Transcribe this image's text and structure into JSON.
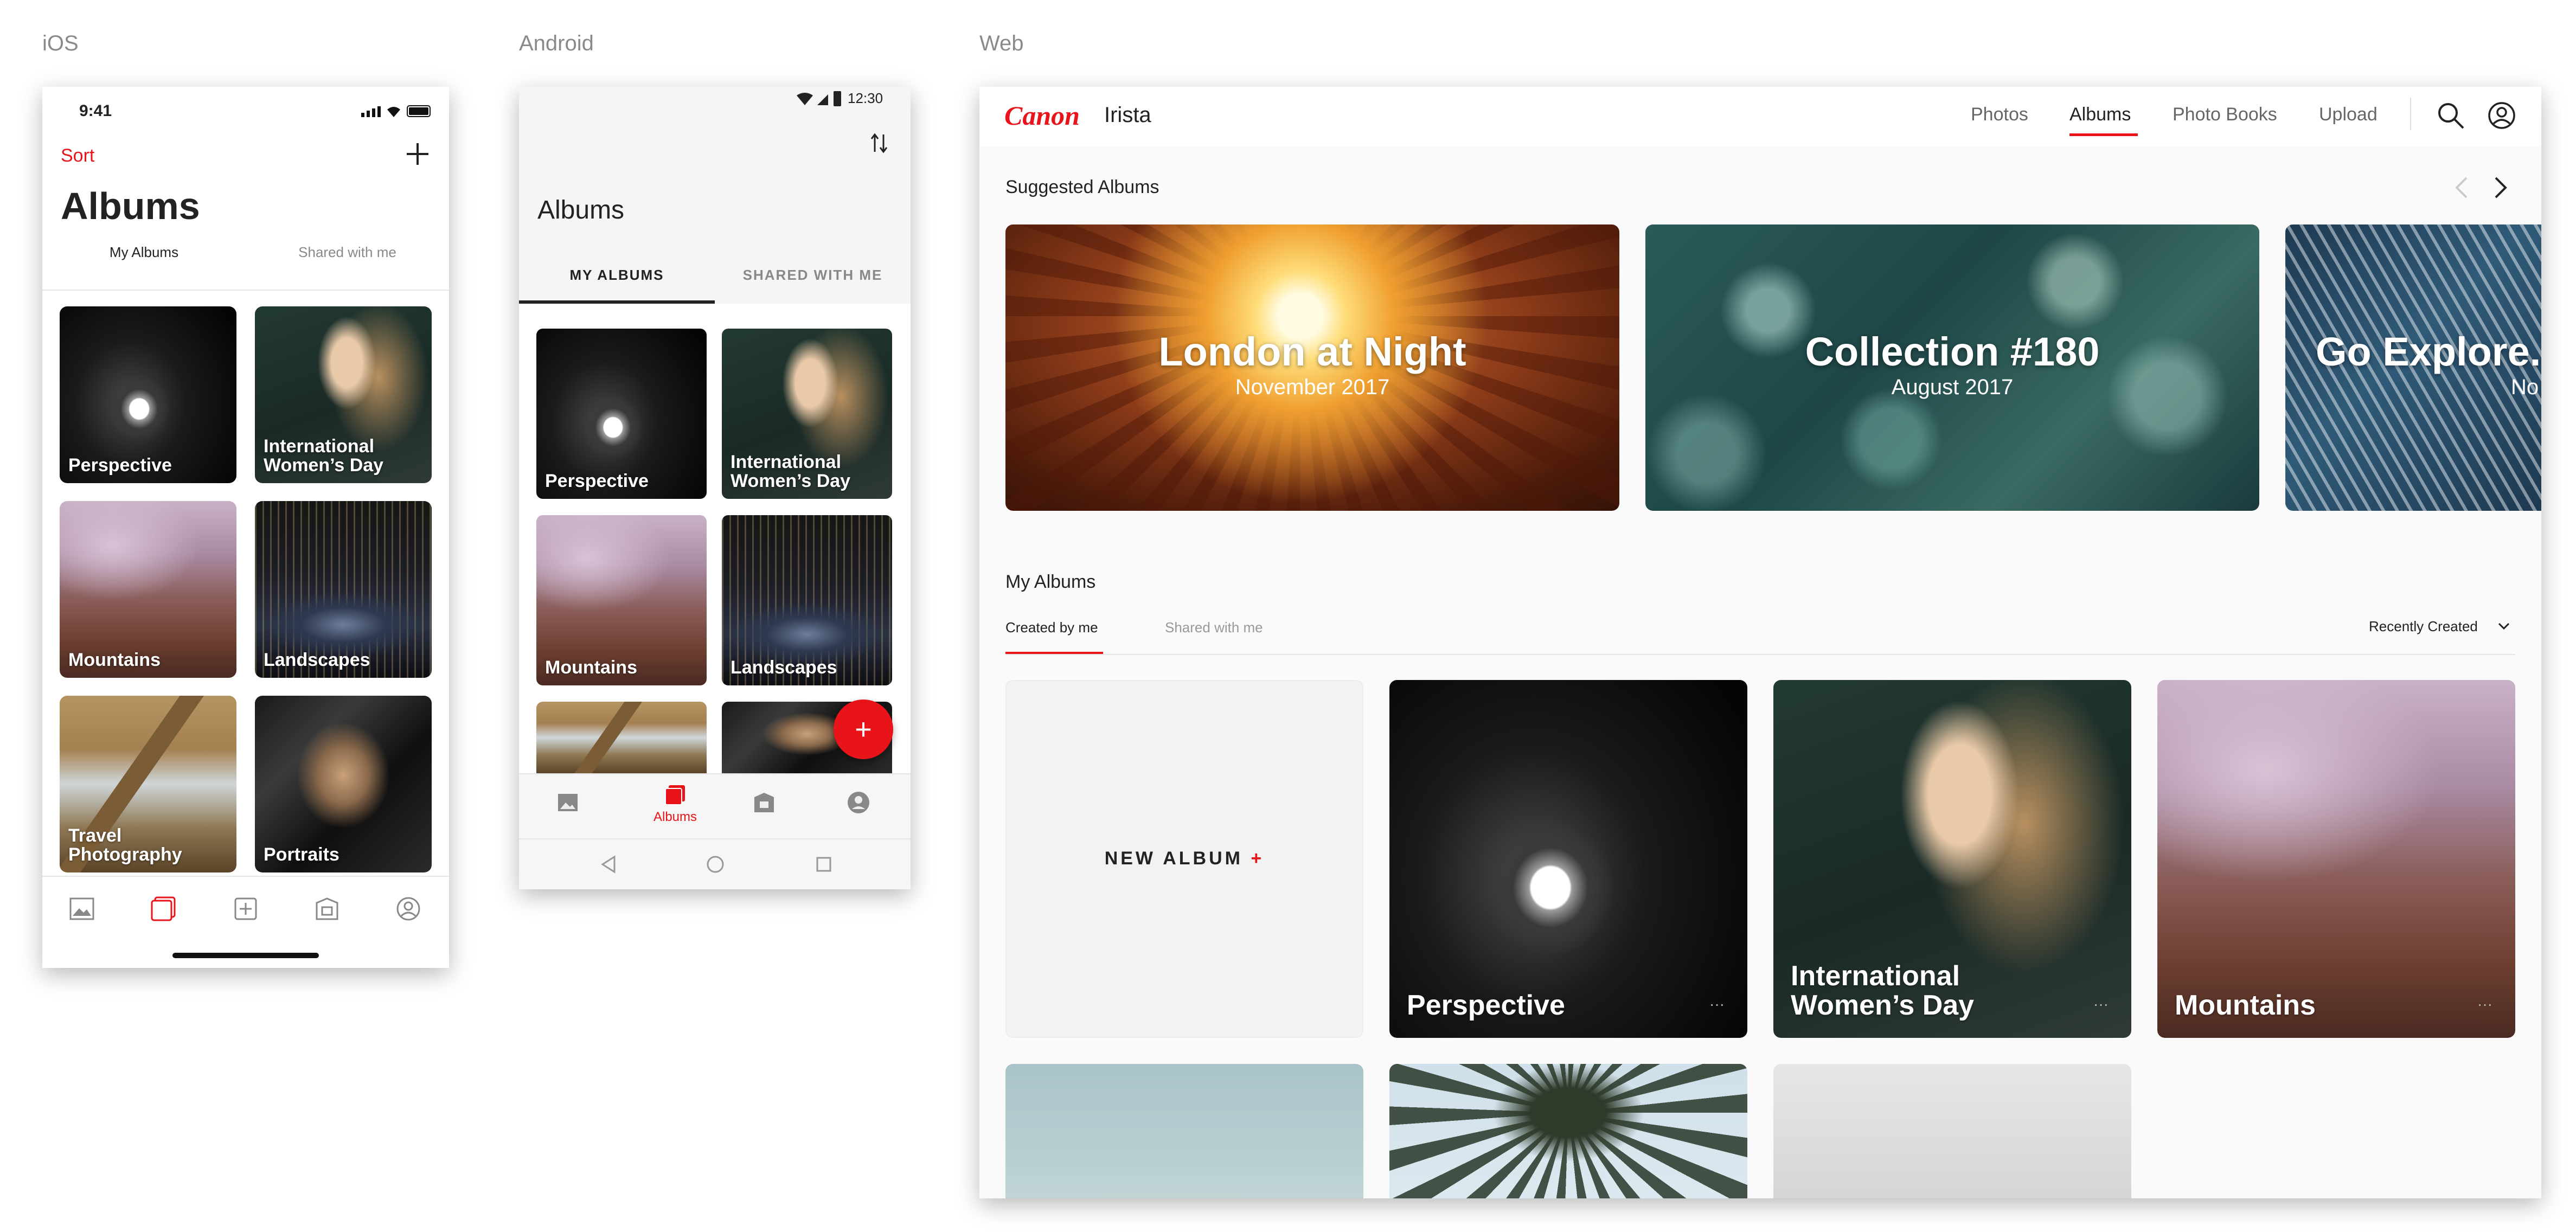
{
  "labels": {
    "ios": "iOS",
    "android": "Android",
    "web": "Web"
  },
  "ios": {
    "time": "9:41",
    "sort": "Sort",
    "title": "Albums",
    "tabs": [
      "My Albums",
      "Shared with me"
    ],
    "albums": [
      "Perspective",
      "International Women’s Day",
      "Mountains",
      "Landscapes",
      "Travel Photography",
      "Portraits"
    ]
  },
  "android": {
    "time": "12:30",
    "title": "Albums",
    "tabs": [
      "MY ALBUMS",
      "SHARED WITH ME"
    ],
    "albums": [
      "Perspective",
      "International Women’s Day",
      "Mountains",
      "Landscapes"
    ],
    "fab": "+",
    "nav_active": "Albums"
  },
  "web": {
    "brand": "Canon",
    "product": "Irista",
    "nav": [
      "Photos",
      "Albums",
      "Photo Books",
      "Upload"
    ],
    "suggested_title": "Suggested Albums",
    "suggested": [
      {
        "title": "London at Night",
        "date": "November 2017"
      },
      {
        "title": "Collection #180",
        "date": "August 2017"
      },
      {
        "title": "Go Explore.",
        "date": "No"
      }
    ],
    "my_albums_title": "My Albums",
    "tabs": [
      "Created by me",
      "Shared with me"
    ],
    "sort": "Recently Created",
    "new_album": "NEW ALBUM",
    "new_album_plus": "+",
    "albums": [
      "Perspective",
      "International Women’s Day",
      "Mountains"
    ],
    "more": "···"
  },
  "colors": {
    "accent": "#e8141a",
    "text": "#222222",
    "muted": "#8a8a8a"
  }
}
